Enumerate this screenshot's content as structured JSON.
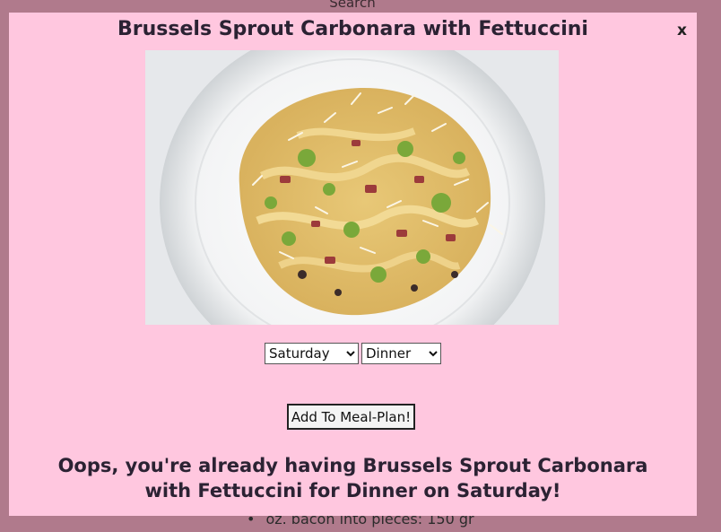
{
  "background": {
    "search_label": "Search",
    "list_item": "oz. bacon into pieces: 150 gr"
  },
  "modal": {
    "title": "Brussels Sprout Carbonara with Fettuccini",
    "close_label": "x",
    "image_subject": "plate-of-brussels-sprout-carbonara",
    "day_select": {
      "selected": "Saturday"
    },
    "meal_select": {
      "selected": "Dinner"
    },
    "add_button_label": "Add To Meal-Plan!",
    "message": "Oops, you're already having Brussels Sprout Carbonara with Fettuccini for Dinner on Saturday!"
  },
  "colors": {
    "overlay": "#b07a8c",
    "modal_bg": "#ffc7df",
    "text": "#2b2233"
  }
}
